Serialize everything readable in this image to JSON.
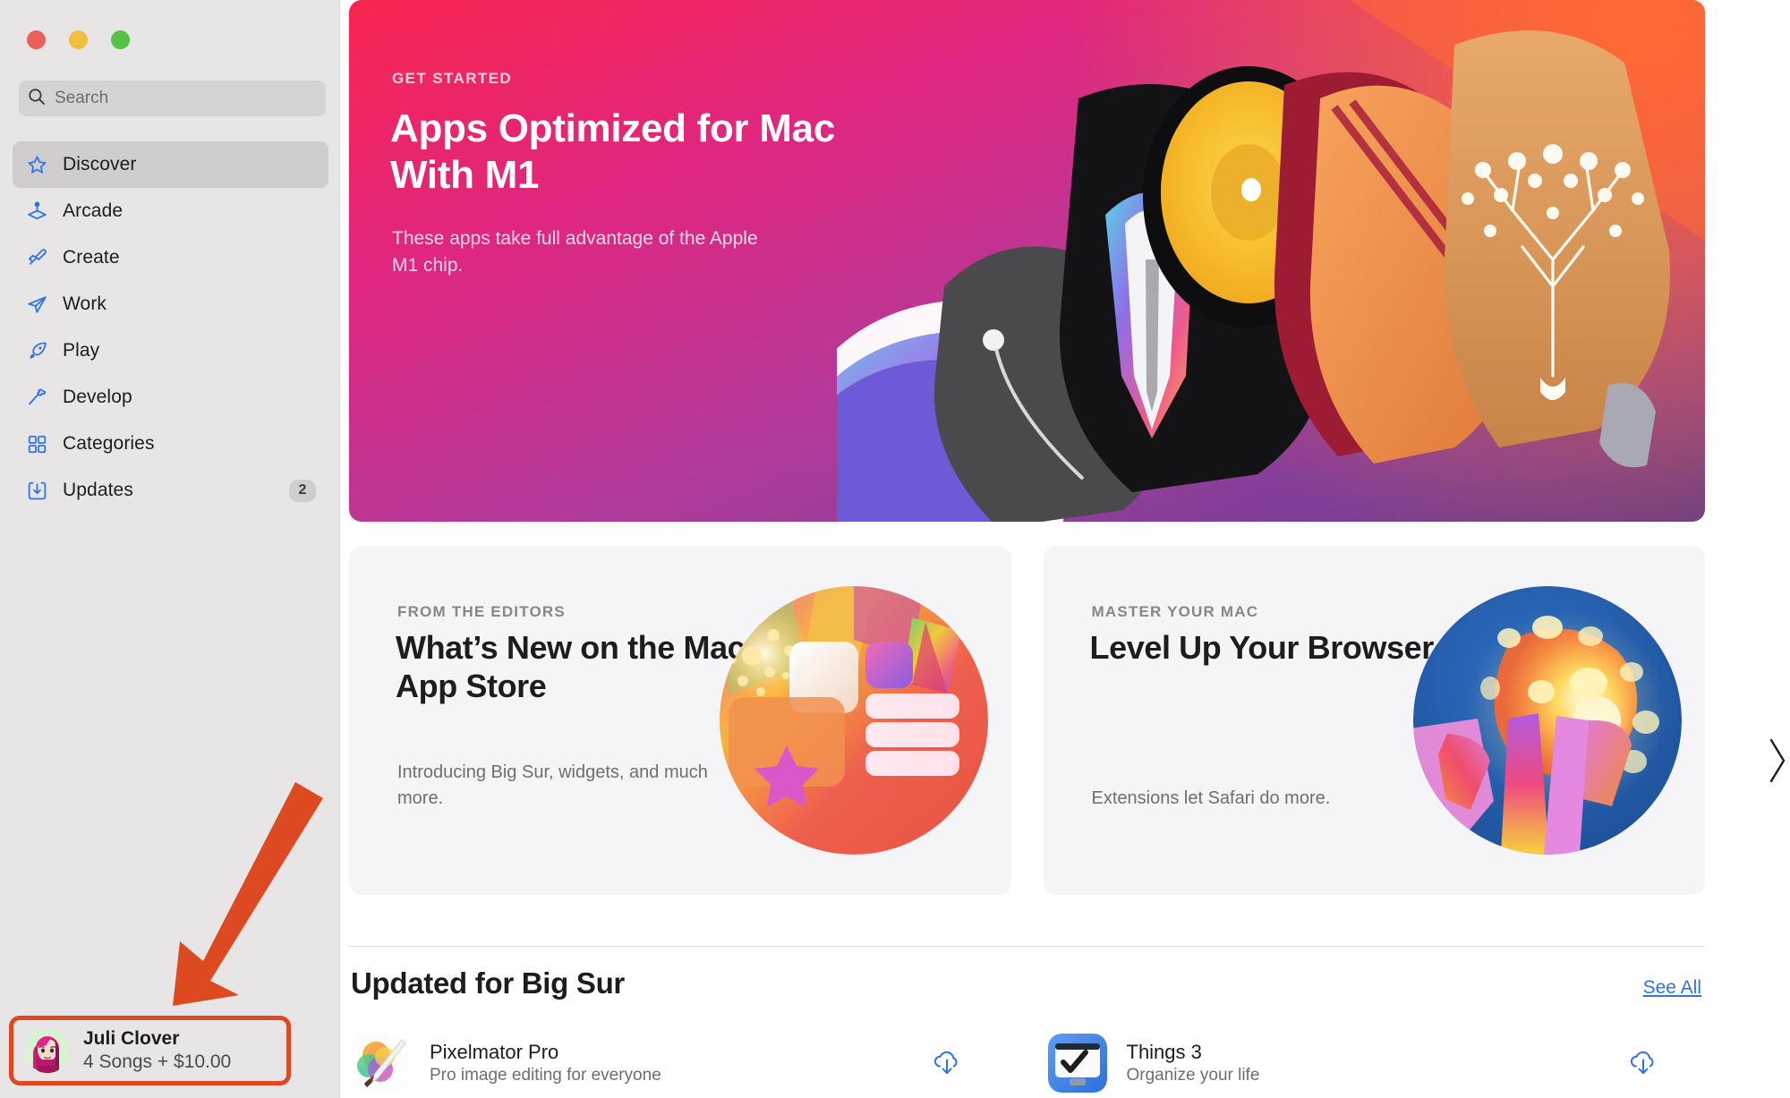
{
  "window": {
    "traffic_lights": [
      {
        "name": "close",
        "color": "#e8615a"
      },
      {
        "name": "minimize",
        "color": "#f3bd40"
      },
      {
        "name": "zoom",
        "color": "#55c146"
      }
    ]
  },
  "sidebar": {
    "search": {
      "placeholder": "Search",
      "value": ""
    },
    "items": [
      {
        "label": "Discover",
        "icon": "star-icon",
        "active": true,
        "badge": ""
      },
      {
        "label": "Arcade",
        "icon": "joystick-icon",
        "active": false,
        "badge": ""
      },
      {
        "label": "Create",
        "icon": "paintbrush-icon",
        "active": false,
        "badge": ""
      },
      {
        "label": "Work",
        "icon": "paperplane-icon",
        "active": false,
        "badge": ""
      },
      {
        "label": "Play",
        "icon": "rocket-icon",
        "active": false,
        "badge": ""
      },
      {
        "label": "Develop",
        "icon": "hammer-icon",
        "active": false,
        "badge": ""
      },
      {
        "label": "Categories",
        "icon": "grid-icon",
        "active": false,
        "badge": ""
      },
      {
        "label": "Updates",
        "icon": "download-icon",
        "active": false,
        "badge": "2"
      }
    ],
    "account": {
      "name": "Juli Clover",
      "balance": "4 Songs + $10.00",
      "avatar": "memoji-avatar"
    }
  },
  "annotation": {
    "arrow_color": "#dd4a21",
    "highlight_color": "#dd4a21"
  },
  "hero": {
    "eyebrow": "GET STARTED",
    "title": "Apps Optimized for Mac With M1",
    "subtitle": "These apps take full advantage of the Apple M1 chip.",
    "artwork": "app-icons-collage-artwork"
  },
  "carousel": {
    "prev_icon": "chevron-left-icon",
    "next_icon": "chevron-right-icon"
  },
  "cards": [
    {
      "eyebrow": "FROM THE EDITORS",
      "title": "What’s New on the Mac App Store",
      "subtitle": "Introducing Big Sur, widgets, and much more.",
      "artwork": "widgets-circle-artwork"
    },
    {
      "eyebrow": "MASTER YOUR MAC",
      "title": "Level Up Your Browser",
      "subtitle": "Extensions let Safari do more.",
      "artwork": "safari-extensions-circle-artwork"
    }
  ],
  "section": {
    "title": "Updated for Big Sur",
    "see_all": "See All",
    "apps": [
      {
        "name": "Pixelmator Pro",
        "description": "Pro image editing for everyone",
        "icon": "pixelmator-pro-icon",
        "action_icon": "cloud-download-icon"
      },
      {
        "name": "Things 3",
        "description": "Organize your life",
        "icon": "things-3-icon",
        "action_icon": "cloud-download-icon"
      }
    ]
  },
  "colors": {
    "accent_blue": "#2f73e8",
    "sidebar_bg": "#e7e5e5",
    "card_bg": "#f5f5f7"
  }
}
